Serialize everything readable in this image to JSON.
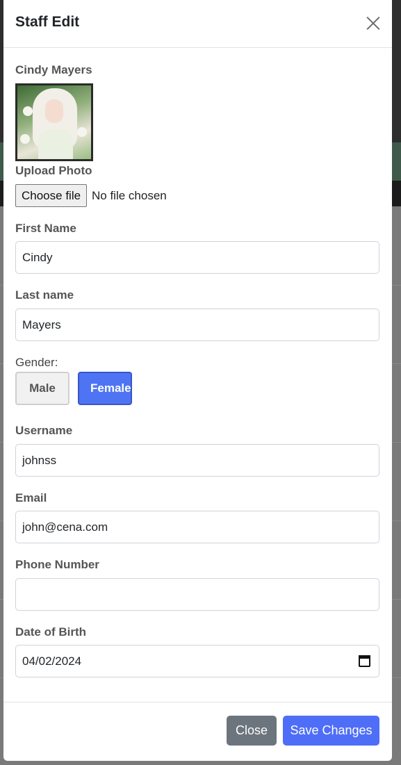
{
  "modal": {
    "title": "Staff Edit",
    "staff_name": "Cindy Mayers"
  },
  "photo": {
    "label": "Upload Photo",
    "choose_file_label": "Choose file",
    "file_status": "No file chosen"
  },
  "form": {
    "first_name": {
      "label": "First Name",
      "value": "Cindy"
    },
    "last_name": {
      "label": "Last name",
      "value": "Mayers"
    },
    "gender": {
      "label": "Gender:",
      "options": [
        "Male",
        "Female"
      ],
      "selected": "Female"
    },
    "username": {
      "label": "Username",
      "value": "johnss"
    },
    "email": {
      "label": "Email",
      "value": "john@cena.com"
    },
    "phone": {
      "label": "Phone Number",
      "value": ""
    },
    "dob": {
      "label": "Date of Birth",
      "value": "04/02/2024"
    }
  },
  "footer": {
    "close_label": "Close",
    "save_label": "Save Changes"
  },
  "colors": {
    "primary": "#4f6ef7",
    "secondary": "#6c757d",
    "selected_toggle": "#4f74f3"
  },
  "icons": [
    "close-icon",
    "calendar-icon"
  ]
}
